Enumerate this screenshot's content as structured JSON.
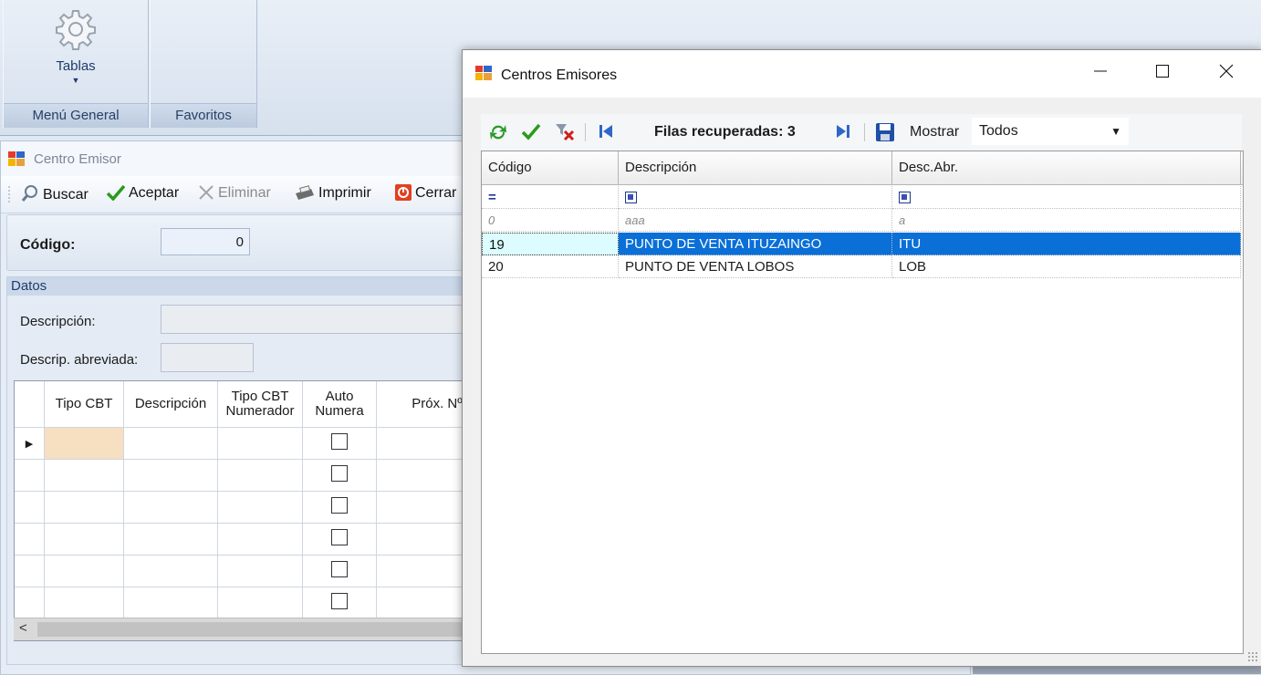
{
  "ribbon": {
    "tablas_label": "Tablas",
    "group_menu_general": "Menú General",
    "group_favoritos": "Favoritos"
  },
  "child_window": {
    "title": "Centro Emisor",
    "toolbar": {
      "buscar": "Buscar",
      "aceptar": "Aceptar",
      "eliminar": "Eliminar",
      "imprimir": "Imprimir",
      "cerrar": "Cerrar"
    },
    "codigo_label": "Código:",
    "codigo_value": "0",
    "datos_header": "Datos",
    "descripcion_label": "Descripción:",
    "descrip_abreviada_label": "Descrip. abreviada:",
    "grid": {
      "columns": [
        "Tipo CBT",
        "Descripción",
        "Tipo CBT Numerador",
        "Auto Numera",
        "Próx. Nº"
      ],
      "row_count": 7
    }
  },
  "dialog": {
    "title": "Centros Emisores",
    "filas_recuperadas": "Filas recuperadas: 3",
    "mostrar_label": "Mostrar",
    "mostrar_value": "Todos",
    "columns": [
      "Código",
      "Descripción",
      "Desc.Abr."
    ],
    "new_row": [
      "0",
      "aaa",
      "a"
    ],
    "rows": [
      {
        "codigo": "19",
        "descripcion": "PUNTO DE VENTA ITUZAINGO",
        "abr": "ITU",
        "selected": true
      },
      {
        "codigo": "20",
        "descripcion": "PUNTO DE VENTA LOBOS",
        "abr": "LOB",
        "selected": false
      }
    ]
  },
  "colors": {
    "selection": "#0a6fd6",
    "ribbon_text": "#1f3b6b",
    "current_cell": "#dcfcff"
  }
}
